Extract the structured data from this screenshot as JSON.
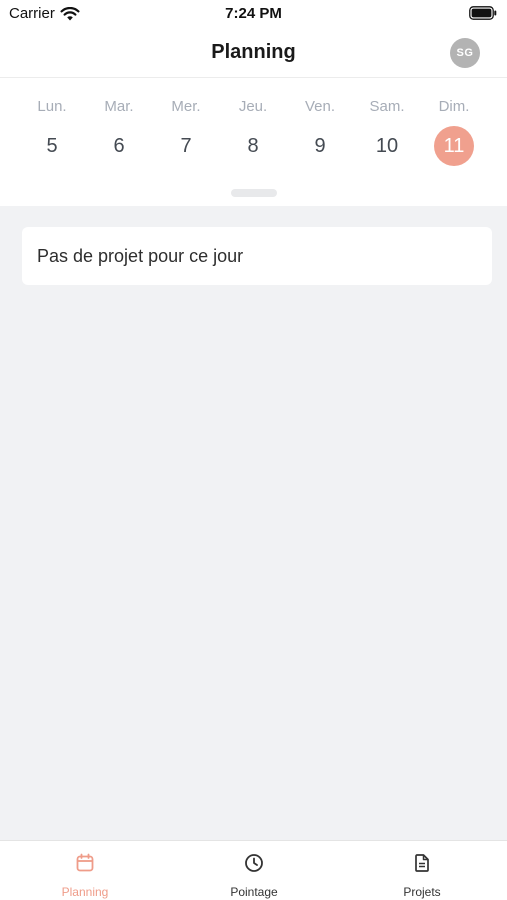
{
  "status_bar": {
    "carrier": "Carrier",
    "time": "7:24 PM"
  },
  "header": {
    "title": "Planning",
    "avatar_initials": "SG"
  },
  "week": {
    "days": [
      {
        "name": "Lun.",
        "number": "5"
      },
      {
        "name": "Mar.",
        "number": "6"
      },
      {
        "name": "Mer.",
        "number": "7"
      },
      {
        "name": "Jeu.",
        "number": "8"
      },
      {
        "name": "Ven.",
        "number": "9"
      },
      {
        "name": "Sam.",
        "number": "10"
      },
      {
        "name": "Dim.",
        "number": "11"
      }
    ],
    "selected_day": "11"
  },
  "content": {
    "empty_message": "Pas de projet pour ce jour"
  },
  "tabbar": {
    "tabs": [
      {
        "label": "Planning",
        "icon": "calendar-icon",
        "active": true
      },
      {
        "label": "Pointage",
        "icon": "clock-icon",
        "active": false
      },
      {
        "label": "Projets",
        "icon": "document-icon",
        "active": false
      }
    ]
  },
  "colors": {
    "accent": "#f0a08e",
    "background": "#f1f2f4",
    "day_name": "#a7adb7"
  }
}
